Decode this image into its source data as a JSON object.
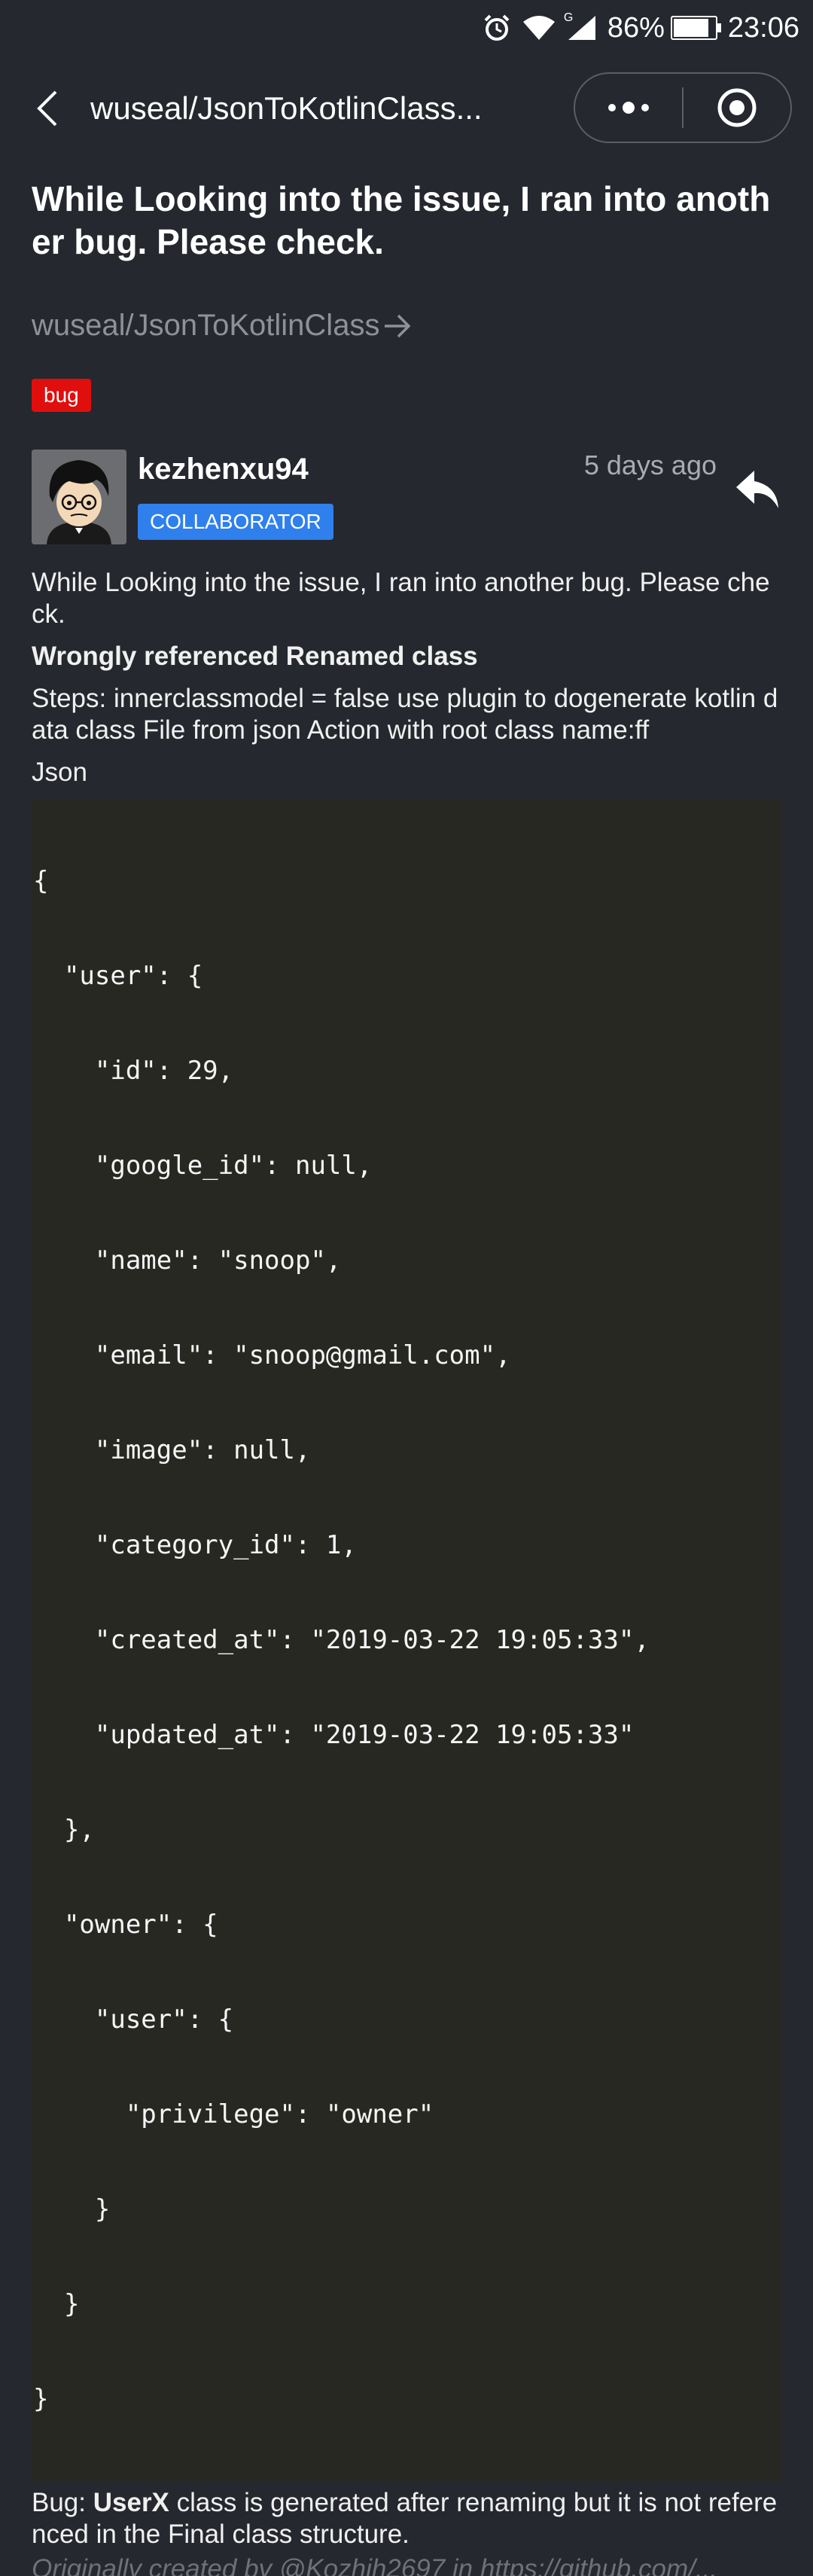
{
  "status_bar": {
    "signal_label": "G",
    "battery_percent": "86%",
    "battery_level": 0.86,
    "time": "23:06"
  },
  "nav": {
    "title": "wuseal/JsonToKotlinClass..."
  },
  "issue": {
    "title": "While Looking into the issue, I ran into another bug. Please check.",
    "repo": "wuseal/JsonToKotlinClass",
    "label": "bug"
  },
  "comment": {
    "author": "kezhenxu94",
    "role": "COLLABORATOR",
    "time": "5 days ago",
    "intro": "While Looking into the issue, I ran into another bug. Please check.",
    "subhead": "Wrongly referenced Renamed class",
    "steps": "Steps: innerclassmodel = false use plugin to dogenerate kotlin data class File from json Action with root class name:ff",
    "json_label": "Json",
    "code_lines": [
      "{",
      "  \"user\": {",
      "    \"id\": 29,",
      "    \"google_id\": null,",
      "    \"name\": \"snoop\",",
      "    \"email\": \"snoop@gmail.com\",",
      "    \"image\": null,",
      "    \"category_id\": 1,",
      "    \"created_at\": \"2019-03-22 19:05:33\",",
      "    \"updated_at\": \"2019-03-22 19:05:33\"",
      "  },",
      "  \"owner\": {",
      "    \"user\": {",
      "      \"privilege\": \"owner\"",
      "    }",
      "  }",
      "}"
    ],
    "bug_prefix": "Bug: ",
    "bug_class": "UserX",
    "bug_rest": " class is generated after renaming but it is not referenced in the Final class structure.",
    "trailing_text": "Originally created by @Kozhih2697 in https://github.com/..."
  }
}
